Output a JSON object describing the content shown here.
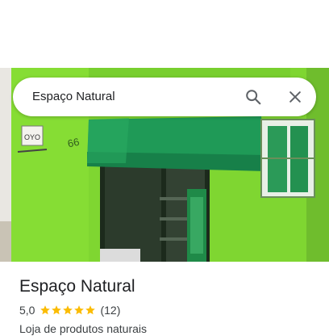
{
  "search": {
    "query": "Espaço Natural"
  },
  "photo": {
    "sign_text": "OYO",
    "door_number": "66"
  },
  "place": {
    "name": "Espaço Natural",
    "rating": "5,0",
    "stars": 5,
    "reviews": "(12)",
    "category": "Loja de produtos naturais"
  },
  "colors": {
    "wall": "#7fd631",
    "awning": "#1f9a57",
    "star": "#fbbc04"
  }
}
